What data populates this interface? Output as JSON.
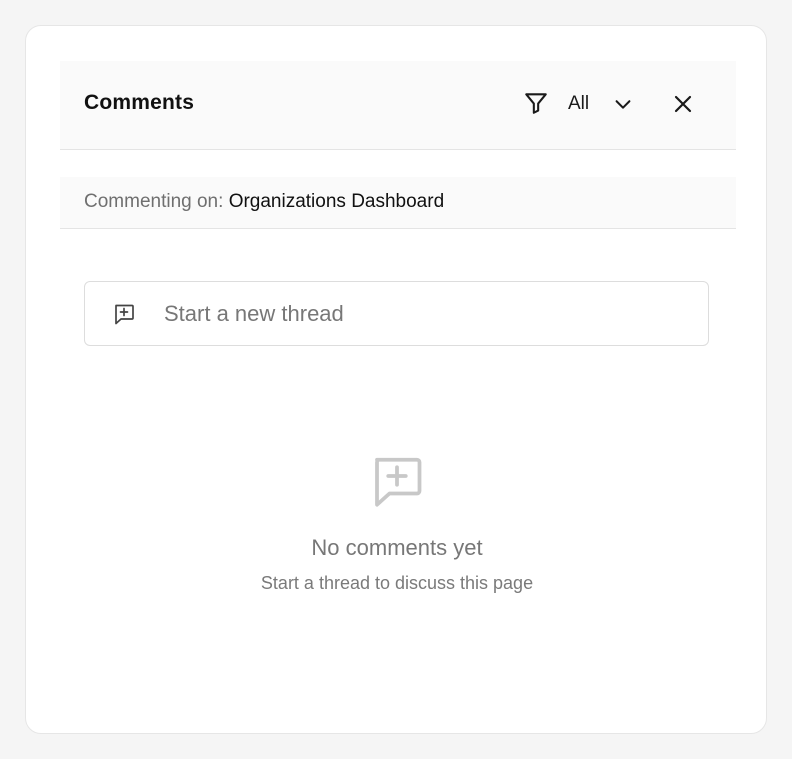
{
  "header": {
    "title": "Comments",
    "filter_icon": "filter-funnel-icon",
    "filter_value": "All",
    "dropdown_icon": "chevron-down-icon",
    "close_icon": "close-x-icon"
  },
  "context": {
    "label": "Commenting on: ",
    "target": "Organizations Dashboard"
  },
  "new_thread": {
    "icon": "message-plus-icon",
    "placeholder": "Start a new thread"
  },
  "empty_state": {
    "icon": "message-plus-icon",
    "title": "No comments yet",
    "subtitle": "Start a thread to discuss this page"
  },
  "colors": {
    "page_background": "#f5f5f5",
    "panel_background": "#ffffff",
    "header_background": "#fafafa",
    "border": "#e4e4e4",
    "text_primary": "#111111",
    "text_muted": "#777777",
    "icon_muted": "#c8c8c8"
  }
}
